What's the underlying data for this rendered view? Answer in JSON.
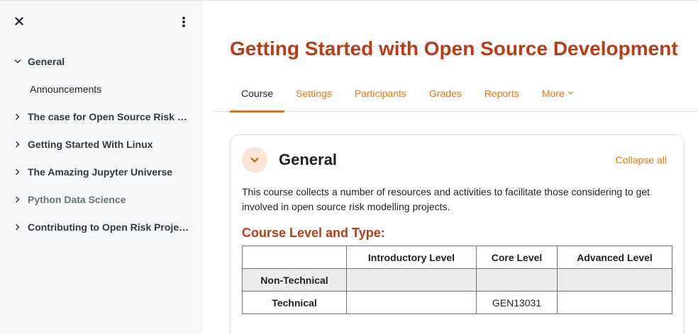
{
  "drawer": {
    "close_icon": "close-icon",
    "menu_icon": "kebab-menu-icon",
    "course_index": [
      {
        "label": "General",
        "expanded": true,
        "dim": false
      },
      {
        "label": "The case for Open Source Risk Modelling",
        "expanded": false,
        "dim": false
      },
      {
        "label": "Getting Started With Linux",
        "expanded": false,
        "dim": false
      },
      {
        "label": "The Amazing Jupyter Universe",
        "expanded": false,
        "dim": false
      },
      {
        "label": "Python Data Science",
        "expanded": false,
        "dim": true
      },
      {
        "label": "Contributing to Open Risk Projects",
        "expanded": false,
        "dim": false
      }
    ],
    "general_children": [
      "Announcements"
    ]
  },
  "page": {
    "title": "Getting Started with Open Source Development"
  },
  "tabs": [
    {
      "label": "Course",
      "active": true
    },
    {
      "label": "Settings",
      "active": false
    },
    {
      "label": "Participants",
      "active": false
    },
    {
      "label": "Grades",
      "active": false
    },
    {
      "label": "Reports",
      "active": false
    },
    {
      "label": "More",
      "active": false
    }
  ],
  "section": {
    "title": "General",
    "collapse_all": "Collapse all",
    "summary": "This course collects a number of resources and activities to facilitate those considering to get involved in open source risk modelling projects.",
    "level_heading": "Course Level and Type:",
    "table": {
      "headers": [
        "",
        "Introductory Level",
        "Core Level",
        "Advanced Level"
      ],
      "rows": [
        [
          "Non-Technical",
          "",
          "",
          ""
        ],
        [
          "Technical",
          "",
          "GEN13031",
          ""
        ]
      ]
    }
  },
  "colors": {
    "brand": "#e7760b",
    "title": "#b83d14",
    "drawer_bg": "#f5f6f7"
  }
}
